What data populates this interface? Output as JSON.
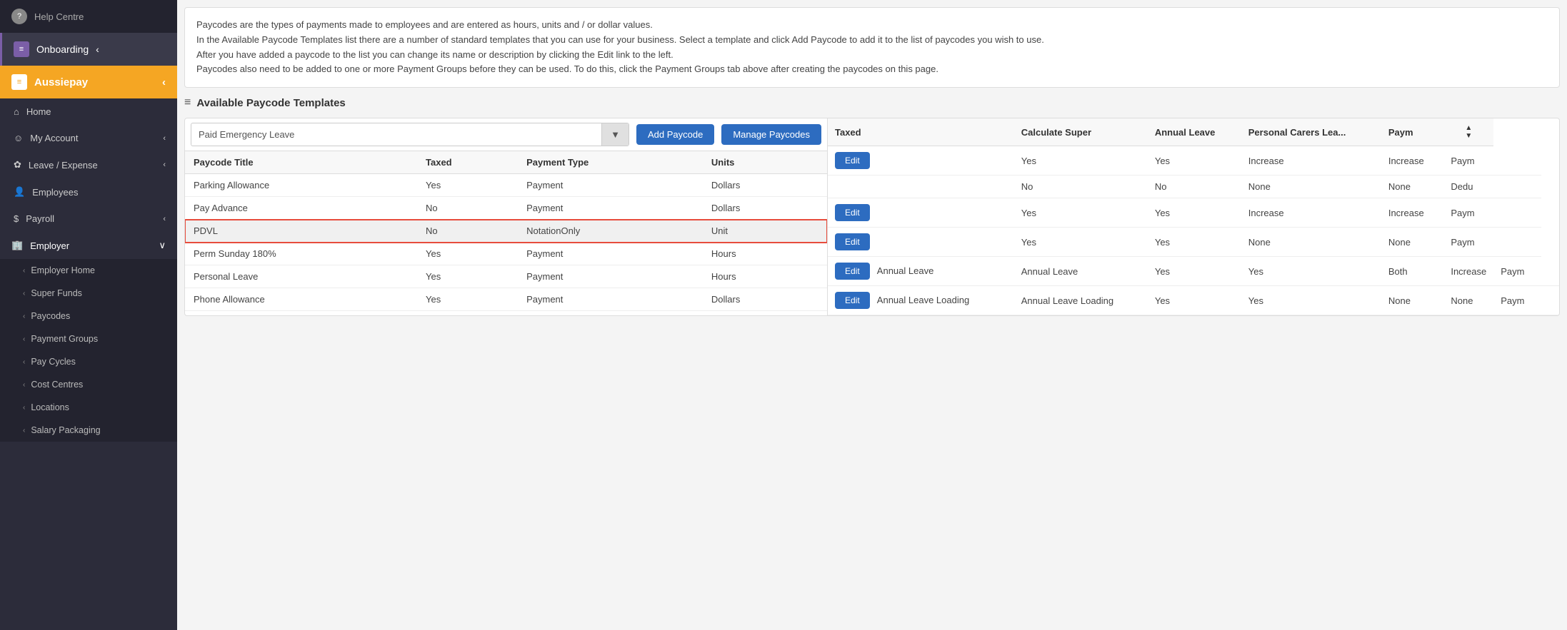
{
  "sidebar": {
    "help_label": "Help Centre",
    "onboarding_label": "Onboarding",
    "app_label": "Aussiepay",
    "nav_items": [
      {
        "id": "home",
        "label": "Home",
        "icon": "home"
      },
      {
        "id": "my-account",
        "label": "My Account",
        "icon": "user",
        "has_chevron": true
      },
      {
        "id": "leave-expense",
        "label": "Leave / Expense",
        "icon": "leaf",
        "has_chevron": true
      },
      {
        "id": "employees",
        "label": "Employees",
        "icon": "people"
      },
      {
        "id": "payroll",
        "label": "Payroll",
        "icon": "dollar",
        "has_chevron": true
      },
      {
        "id": "employer",
        "label": "Employer",
        "icon": "building",
        "has_chevron": true,
        "expanded": true
      }
    ],
    "employer_sub_items": [
      {
        "id": "employer-home",
        "label": "Employer Home"
      },
      {
        "id": "super-funds",
        "label": "Super Funds"
      },
      {
        "id": "paycodes",
        "label": "Paycodes"
      },
      {
        "id": "payment-groups",
        "label": "Payment Groups"
      },
      {
        "id": "pay-cycles",
        "label": "Pay Cycles"
      },
      {
        "id": "cost-centres",
        "label": "Cost Centres"
      },
      {
        "id": "locations",
        "label": "Locations"
      },
      {
        "id": "salary-packaging",
        "label": "Salary Packaging"
      }
    ]
  },
  "info_text": {
    "line1": "Paycodes are the types of payments made to employees and are entered as hours, units and / or dollar values.",
    "line2": "In the Available Paycode Templates list there are a number of standard templates that you can use for your business. Select a template and click Add Paycode to add it to the list of paycodes you wish to use.",
    "line3": "After you have added a paycode to the list you can change its name or description by clicking the Edit link to the left.",
    "line4": "Paycodes also need to be added to one or more Payment Groups before they can be used. To do this, click the Payment Groups tab above after creating the paycodes on this page."
  },
  "section_title": "Available Paycode Templates",
  "dropdown": {
    "selected": "Paid Emergency Leave",
    "placeholder": "Paid Emergency Leave"
  },
  "buttons": {
    "add_paycode": "Add Paycode",
    "manage_paycodes": "Manage Paycodes",
    "edit": "Edit"
  },
  "left_table": {
    "headers": [
      "Paycode Title",
      "Taxed",
      "Payment Type",
      "Units"
    ],
    "rows": [
      {
        "title": "Parking Allowance",
        "taxed": "Yes",
        "payment_type": "Payment",
        "units": "Dollars",
        "highlighted": false
      },
      {
        "title": "Pay Advance",
        "taxed": "No",
        "payment_type": "Payment",
        "units": "Dollars",
        "highlighted": false
      },
      {
        "title": "PDVL",
        "taxed": "No",
        "payment_type": "NotationOnly",
        "units": "Unit",
        "highlighted": true
      },
      {
        "title": "Perm Sunday 180%",
        "taxed": "Yes",
        "payment_type": "Payment",
        "units": "Hours",
        "highlighted": false
      },
      {
        "title": "Personal Leave",
        "taxed": "Yes",
        "payment_type": "Payment",
        "units": "Hours",
        "highlighted": false
      },
      {
        "title": "Phone Allowance",
        "taxed": "Yes",
        "payment_type": "Payment",
        "units": "Dollars",
        "highlighted": false
      }
    ]
  },
  "right_table": {
    "headers": [
      "Taxed",
      "Calculate Super",
      "Annual Leave",
      "Personal Carers Leave",
      "Paym"
    ],
    "rows": [
      {
        "edit": true,
        "taxed": "Yes",
        "calc_super": "Yes",
        "annual_leave": "Increase",
        "personal_carers": "Increase",
        "paym": "Paym"
      },
      {
        "edit": false,
        "taxed": "No",
        "calc_super": "No",
        "annual_leave": "None",
        "personal_carers": "None",
        "paym": "Dedu"
      },
      {
        "edit": true,
        "taxed": "Yes",
        "calc_super": "Yes",
        "annual_leave": "Increase",
        "personal_carers": "Increase",
        "paym": "Paym"
      },
      {
        "edit": true,
        "taxed": "Yes",
        "calc_super": "Yes",
        "annual_leave": "None",
        "personal_carers": "None",
        "paym": "Paym"
      },
      {
        "edit": true,
        "label": "Annual Leave",
        "desc": "Annual Leave",
        "taxed": "Yes",
        "calc_super": "Yes",
        "annual_leave": "Both",
        "personal_carers": "Increase",
        "paym": "Paym"
      },
      {
        "edit": true,
        "label": "Annual Leave Loading",
        "desc": "Annual Leave Loading",
        "taxed": "Yes",
        "calc_super": "Yes",
        "annual_leave": "None",
        "personal_carers": "None",
        "paym": "Paym"
      }
    ]
  }
}
